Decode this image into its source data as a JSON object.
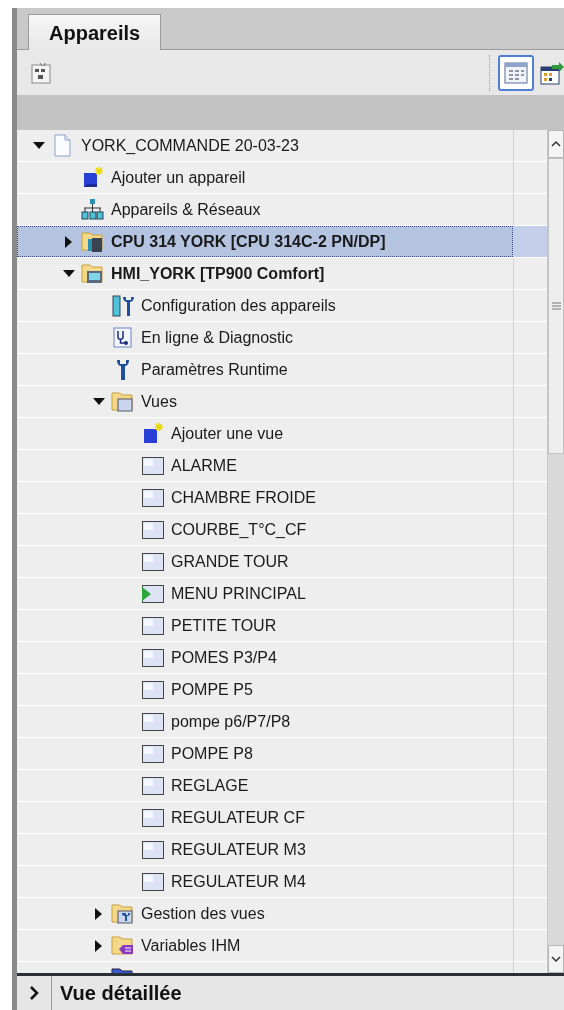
{
  "tabs": [
    {
      "label": "Appareils",
      "selected": true
    }
  ],
  "toolbar": {
    "view_toggle": {
      "selected": true
    }
  },
  "tree": [
    {
      "label": "YORK_COMMANDE 20-03-23",
      "kind": "project",
      "expanded": true,
      "selected": false,
      "children": [
        {
          "label": "Ajouter un appareil",
          "kind": "add-device",
          "selected": false
        },
        {
          "label": "Appareils & Réseaux",
          "kind": "network",
          "selected": false
        },
        {
          "label": "CPU 314 YORK [CPU 314C-2 PN/DP]",
          "kind": "plc",
          "bold": true,
          "expanded": false,
          "selected": true
        },
        {
          "label": "HMI_YORK [TP900 Comfort]",
          "kind": "hmi",
          "bold": true,
          "expanded": true,
          "selected": false,
          "children": [
            {
              "label": "Configuration des appareils",
              "kind": "device-config",
              "selected": false
            },
            {
              "label": "En ligne & Diagnostic",
              "kind": "online-diag",
              "selected": false
            },
            {
              "label": "Paramètres Runtime",
              "kind": "runtime",
              "selected": false
            },
            {
              "label": "Vues",
              "kind": "folder",
              "expanded": true,
              "selected": false,
              "children": [
                {
                  "label": "Ajouter une vue",
                  "kind": "add-screen",
                  "selected": false
                },
                {
                  "label": "ALARME",
                  "kind": "screen",
                  "selected": false
                },
                {
                  "label": "CHAMBRE FROIDE",
                  "kind": "screen",
                  "selected": false
                },
                {
                  "label": "COURBE_T°C_CF",
                  "kind": "screen",
                  "selected": false
                },
                {
                  "label": "GRANDE TOUR",
                  "kind": "screen",
                  "selected": false
                },
                {
                  "label": "MENU PRINCIPAL",
                  "kind": "start-screen",
                  "selected": false
                },
                {
                  "label": "PETITE TOUR",
                  "kind": "screen",
                  "selected": false
                },
                {
                  "label": "POMES P3/P4",
                  "kind": "screen",
                  "selected": false
                },
                {
                  "label": "POMPE P5",
                  "kind": "screen",
                  "selected": false
                },
                {
                  "label": "pompe p6/P7/P8",
                  "kind": "screen",
                  "selected": false
                },
                {
                  "label": "POMPE P8",
                  "kind": "screen",
                  "selected": false
                },
                {
                  "label": "REGLAGE",
                  "kind": "screen",
                  "selected": false
                },
                {
                  "label": "REGULATEUR CF",
                  "kind": "screen",
                  "selected": false
                },
                {
                  "label": "REGULATEUR M3",
                  "kind": "screen",
                  "selected": false
                },
                {
                  "label": "REGULATEUR M4",
                  "kind": "screen",
                  "selected": false
                }
              ]
            },
            {
              "label": "Gestion des vues",
              "kind": "screen-management",
              "expanded": false,
              "selected": false
            },
            {
              "label": "Variables IHM",
              "kind": "hmi-tags",
              "expanded": false,
              "selected": false
            },
            {
              "kind": "connections",
              "selected": false
            }
          ]
        }
      ]
    }
  ],
  "detail_bar": {
    "label": "Vue détaillée",
    "expanded": false
  }
}
